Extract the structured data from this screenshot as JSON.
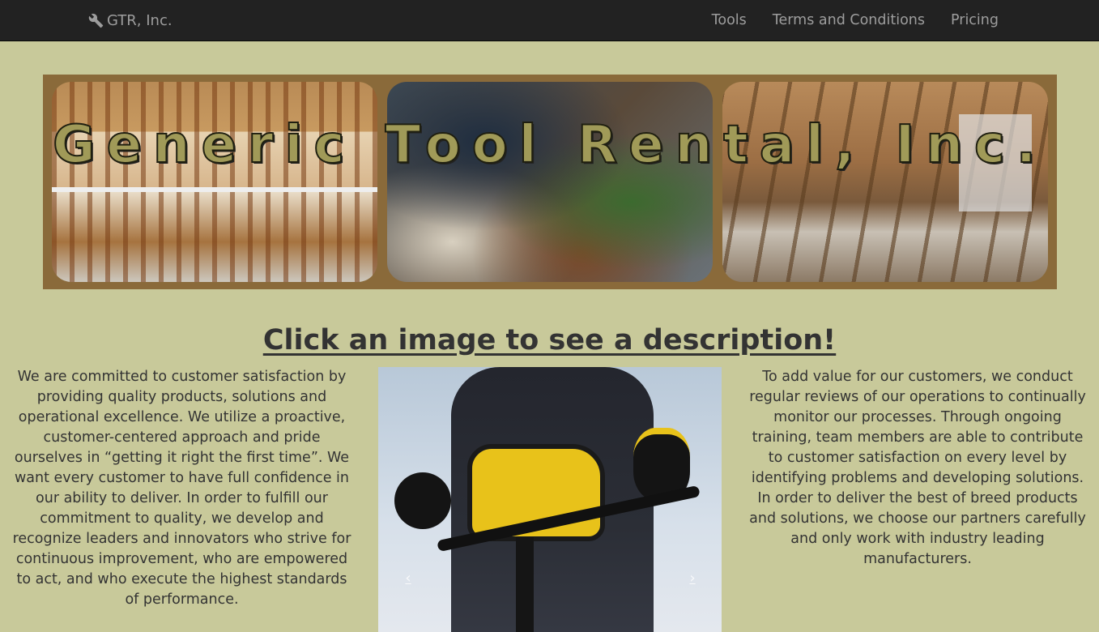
{
  "navbar": {
    "brand": "GTR, Inc.",
    "brand_icon": "wrench-icon",
    "links": [
      "Tools",
      "Terms and Conditions",
      "Pricing"
    ]
  },
  "banner": {
    "title": "Generic Tool Rental, Inc."
  },
  "headline": "Click an image to see a description!",
  "left_text": "We are committed to customer satisfaction by providing quality products, solutions and operational excellence. We utilize a proactive, customer-centered approach and pride ourselves in “getting it right the first time”. We want every customer to have full confidence in our ability to deliver. In order to fulfill our commitment to quality, we develop and recognize leaders and innovators who strive for continuous improvement, who are empowered to act, and who execute the highest standards of performance.",
  "right_text": "To add value for our customers, we conduct regular reviews of our operations to continually monitor our processes. Through ongoing training, team members are able to contribute to customer satisfaction on every level by identifying problems and developing solutions. In order to deliver the best of breed products and solutions, we choose our partners carefully and only work with industry leading manufacturers.",
  "carousel": {
    "prev": "‹",
    "next": "›"
  },
  "colors": {
    "background": "#c8c99a",
    "navbar": "#222222",
    "banner_frame": "#8a6a3a",
    "title_fill": "#a09a58"
  }
}
